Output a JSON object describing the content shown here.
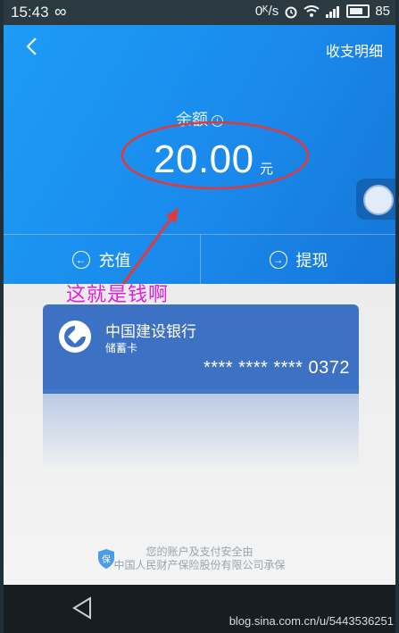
{
  "statusbar": {
    "time": "15:43",
    "infinity": "∞",
    "speed": "0ᴷ/s",
    "battery": "85"
  },
  "header": {
    "detail_link": "收支明细",
    "balance_label": "余额",
    "balance_amount": "20.00",
    "currency": "元"
  },
  "actions": [
    {
      "label": "充值",
      "icon": "arrow-left-circle-icon"
    },
    {
      "label": "提现",
      "icon": "arrow-right-circle-icon"
    }
  ],
  "annotation": {
    "text": "这就是钱啊",
    "color": "#e020d8"
  },
  "card": {
    "bank_name": "中国建设银行",
    "card_type": "储蓄卡",
    "card_number": "**** **** **** 0372"
  },
  "safety": {
    "line1": "您的账户及支付安全由",
    "line2": "中国人民财产保险股份有限公司承保",
    "shield_label": "保"
  },
  "watermark": "blog.sina.com.cn/u/5443536251",
  "colors": {
    "header_blue": "#1a8aec",
    "card_blue": "#3d71c4",
    "annotation_red": "#e03a3a"
  }
}
